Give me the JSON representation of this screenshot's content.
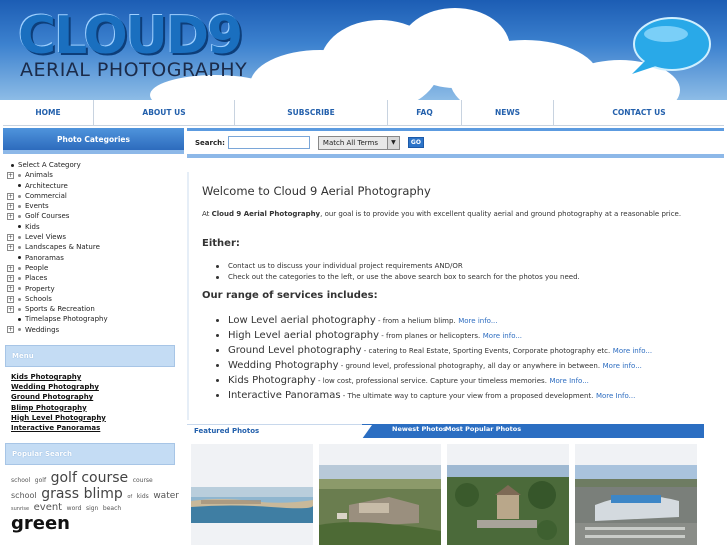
{
  "header": {
    "logo_main": "CLOUD9",
    "logo_sub": "AERIAL PHOTOGRAPHY"
  },
  "nav": {
    "items": [
      {
        "label": "HOME"
      },
      {
        "label": "ABOUT US"
      },
      {
        "label": "SUBSCRIBE"
      },
      {
        "label": "FAQ"
      },
      {
        "label": "NEWS"
      },
      {
        "label": "CONTACT US"
      }
    ]
  },
  "sidebar": {
    "header": "Photo Categories",
    "categories": [
      {
        "label": "Select A Category",
        "expandable": false,
        "first": true
      },
      {
        "label": "Animals",
        "expandable": true
      },
      {
        "label": "Architecture",
        "expandable": false
      },
      {
        "label": "Commercial",
        "expandable": true
      },
      {
        "label": "Events",
        "expandable": true
      },
      {
        "label": "Golf Courses",
        "expandable": true
      },
      {
        "label": "Kids",
        "expandable": false
      },
      {
        "label": "Level Views",
        "expandable": true
      },
      {
        "label": "Landscapes & Nature",
        "expandable": true
      },
      {
        "label": "Panoramas",
        "expandable": false
      },
      {
        "label": "People",
        "expandable": true
      },
      {
        "label": "Places",
        "expandable": true
      },
      {
        "label": "Property",
        "expandable": true
      },
      {
        "label": "Schools",
        "expandable": true
      },
      {
        "label": "Sports & Recreation",
        "expandable": true
      },
      {
        "label": "Timelapse Photography",
        "expandable": false
      },
      {
        "label": "Weddings",
        "expandable": true
      }
    ],
    "menu_header": "Menu",
    "menu_links": [
      "Kids Photography",
      "Wedding Photography",
      "Ground Photography",
      "Blimp Photography",
      "High Level Photography",
      "Interactive Panoramas"
    ],
    "popular_header": "Popular Search",
    "popular_tags": [
      {
        "text": "school",
        "size": 6
      },
      {
        "text": "golf",
        "size": 6
      },
      {
        "text": "golf course",
        "size": 14
      },
      {
        "text": "course",
        "size": 6
      },
      {
        "text": "school",
        "size": 8
      },
      {
        "text": "grass",
        "size": 14
      },
      {
        "text": "blimp",
        "size": 14
      },
      {
        "text": "of",
        "size": 5
      },
      {
        "text": "kids",
        "size": 6
      },
      {
        "text": "water",
        "size": 9
      },
      {
        "text": "sunrise",
        "size": 5
      },
      {
        "text": "event",
        "size": 10
      },
      {
        "text": "word",
        "size": 6
      },
      {
        "text": "sign",
        "size": 6
      },
      {
        "text": "beach",
        "size": 6
      },
      {
        "text": "green",
        "size": 18
      }
    ]
  },
  "search": {
    "label": "Search:",
    "value": "",
    "select_value": "Match All Terms",
    "go_label": "GO"
  },
  "main": {
    "title": "Welcome to Cloud 9 Aerial Photography",
    "intro_prefix": "At ",
    "intro_brand": "Cloud 9 Aerial Photography",
    "intro_suffix": ", our goal is to provide you with excellent quality aerial and ground photography at a reasonable price.",
    "either_heading": "Either:",
    "either_items": [
      "Contact us to discuss your individual project requirements AND/OR",
      "Check out the categories to the left, or use the above search box to search for the photos you need."
    ],
    "range_heading": "Our range of services includes:",
    "services": [
      {
        "title": "Low Level aerial photography",
        "desc": " - from a helium blimp.",
        "more": "More info..."
      },
      {
        "title": "High Level aerial photography",
        "desc": " - from planes or helicopters.",
        "more": "More info..."
      },
      {
        "title": "Ground Level photography",
        "desc": " - catering to Real Estate, Sporting Events, Corporate photography etc.",
        "more": "More info..."
      },
      {
        "title": "Wedding Photography",
        "desc": " - ground level, professional photography, all day or anywhere in between.",
        "more": "More info..."
      },
      {
        "title": "Kids Photography",
        "desc": " - low cost, professional service. Capture your timeless memories.",
        "more": "More Info..."
      },
      {
        "title": "Interactive Panoramas",
        "desc": " - The ultimate way to capture your view from a proposed development.",
        "more": "More Info..."
      }
    ]
  },
  "featured": {
    "active_tab": "Featured Photos",
    "tab_2": "Newest Photos",
    "tab_3": "Most Popular Photos"
  },
  "colors": {
    "accent": "#2d6bbd",
    "link": "#2c6cc0",
    "nav_text": "#2360ac"
  }
}
